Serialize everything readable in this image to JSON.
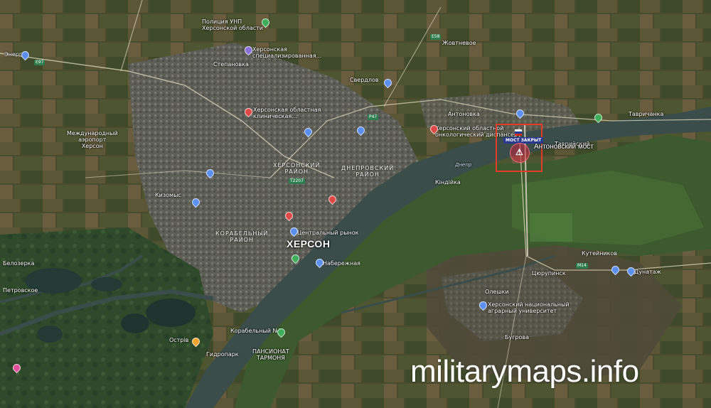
{
  "map": {
    "city_label": "ХЕРСОН",
    "watermark": "militarymaps.info",
    "highlight": {
      "closed_tag": "МОСТ ЗАКРЫТ",
      "warning_icon": "warning-triangle-icon",
      "bridge_name": "Антоновский мост",
      "box_color": "#e23b2a"
    },
    "districts": [
      "ХЕРСОНСКИЙ\nРАЙОН",
      "ДНЕПРОВСКИЙ\nРАЙОН",
      "КОРАБЕЛЬНЫЙ\nРАЙОН"
    ],
    "places": [
      "Полиция УНП\nХерсонской области",
      "Херсонская\nспециализированная...",
      "Степановка",
      "Херсонская областная\nклиническая...",
      "Жовтневое",
      "Свердлов",
      "Международный\nаэропорт\nХерсон",
      "Энергия",
      "Таврийский",
      "Антоновка",
      "Херсонский областной\nонкологический диспансер",
      "Кизомыс",
      "Петровское",
      "Днепр",
      "Кіндійка",
      "Олешки",
      "Гидропарк",
      "ПАНСИОНАТ\nТАРМОНЯ",
      "Набережная",
      "Центральный рынок",
      "Кутейников",
      "Цюрупинск",
      "Бугрова",
      "Дунатаж",
      "Херсонский национальный\nаграрный университет",
      "Тавричанка",
      "Корабельный №1",
      "Острів",
      "Белозерка"
    ],
    "roads": [
      "Е97",
      "Е58",
      "Р47",
      "М14",
      "Т2207"
    ]
  }
}
